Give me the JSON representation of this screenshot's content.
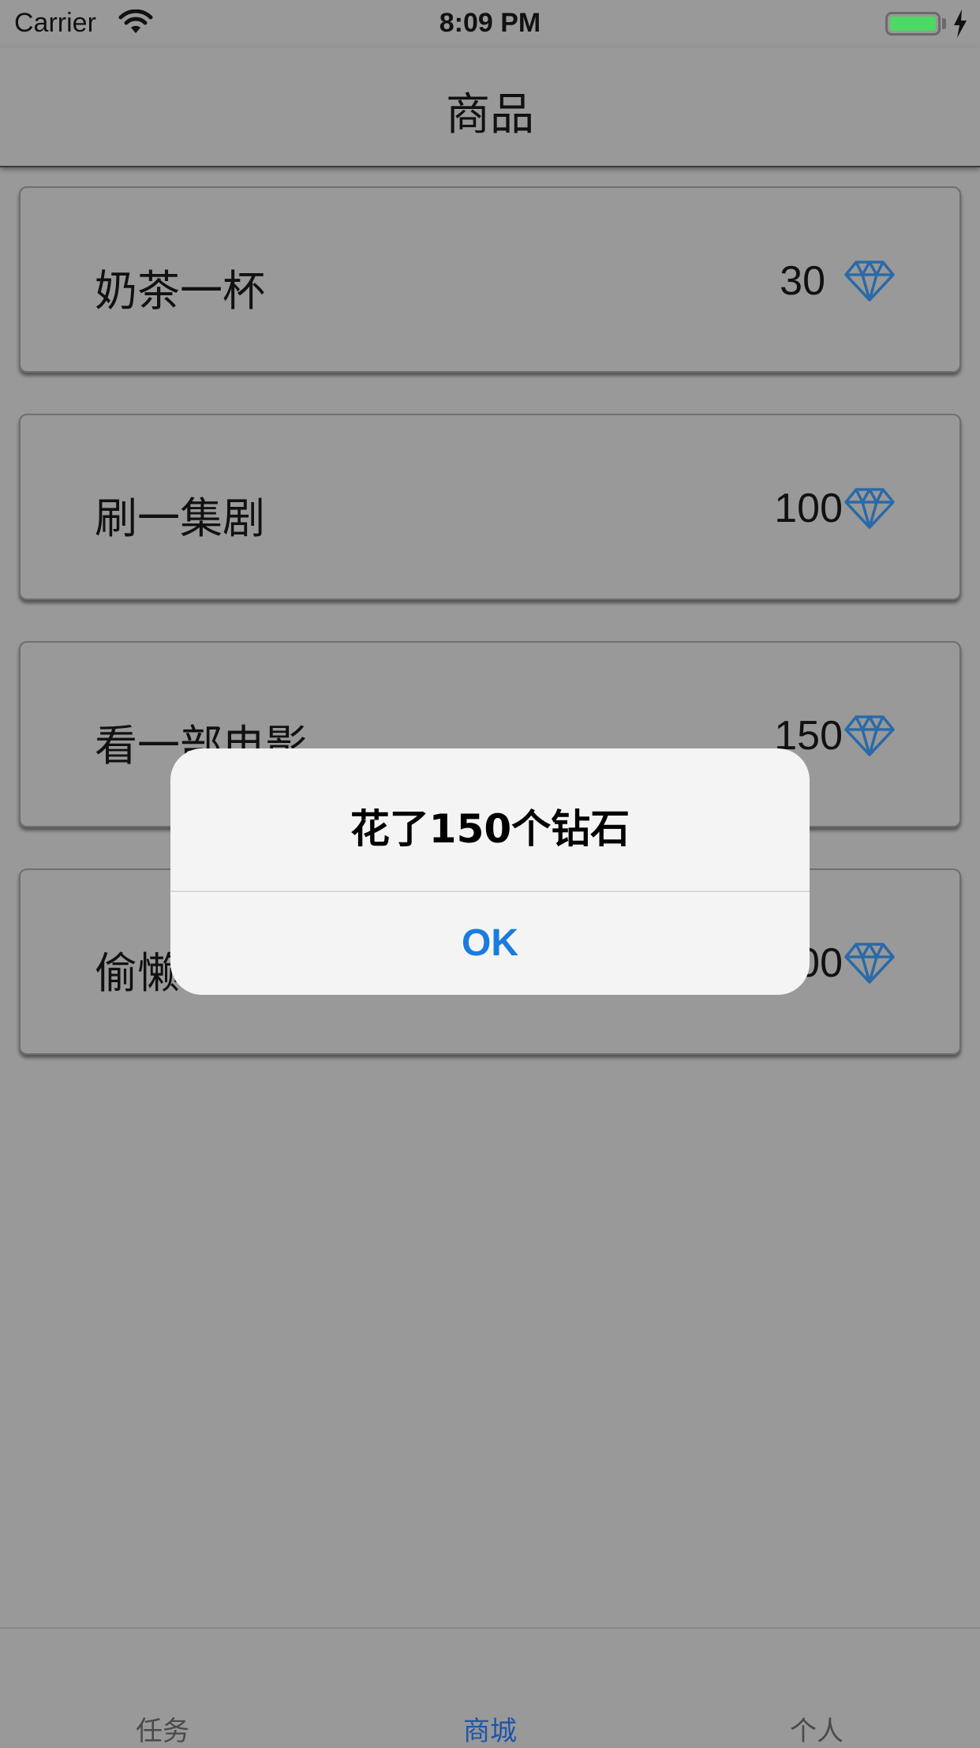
{
  "status_bar": {
    "carrier": "Carrier",
    "time": "8:09 PM",
    "wifi_icon": "wifi-icon",
    "battery_icon": "battery-icon",
    "charging_icon": "bolt-icon"
  },
  "nav": {
    "title": "商品"
  },
  "goods": [
    {
      "name": "奶茶一杯",
      "price": "30",
      "icon": "diamond-icon"
    },
    {
      "name": "刷一集剧",
      "price": "100",
      "icon": "diamond-icon"
    },
    {
      "name": "看一部电影",
      "price": "150",
      "icon": "diamond-icon"
    },
    {
      "name": "偷懒",
      "price": "200",
      "icon": "diamond-icon"
    }
  ],
  "alert": {
    "title": "花了150个钻石",
    "ok_label": "OK"
  },
  "tabs": [
    {
      "label": "任务"
    },
    {
      "label": "商城",
      "active": true
    },
    {
      "label": "个人"
    }
  ],
  "colors": {
    "accent": "#1a7be0",
    "tab_active": "#1e55a8",
    "diamond": "#2a6aa8",
    "battery": "#4cd964",
    "dim_overlay": "#999999"
  }
}
